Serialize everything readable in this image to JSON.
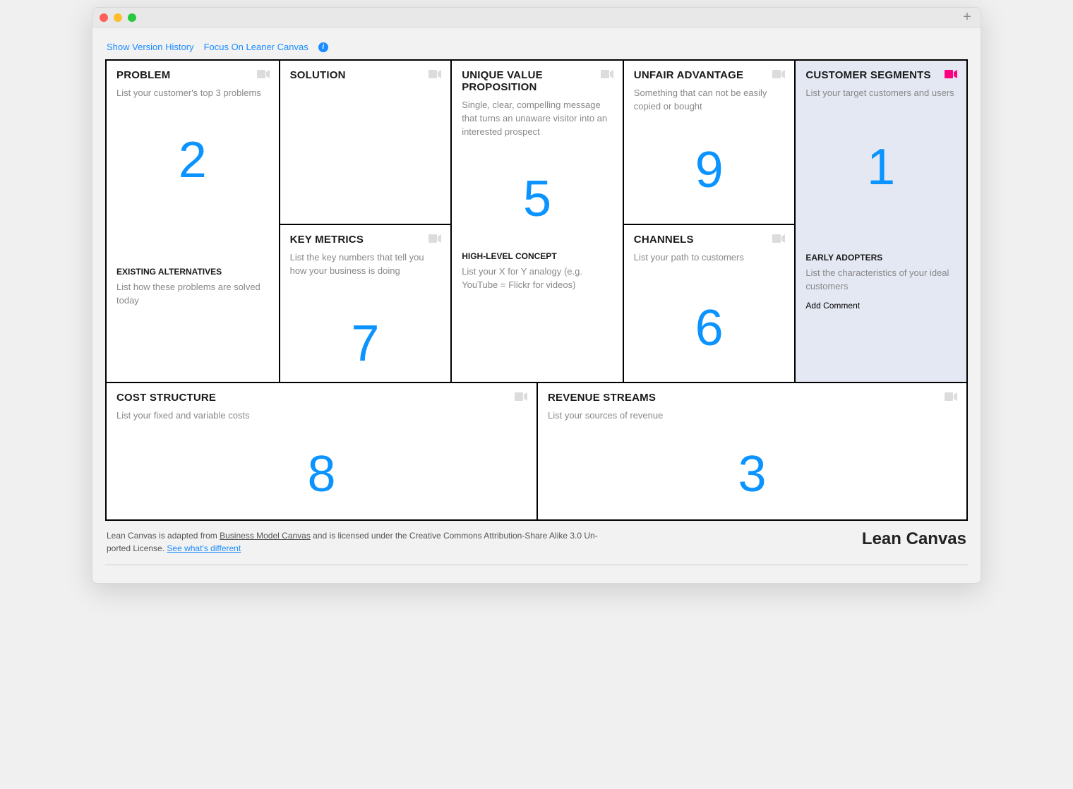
{
  "toolbar": {
    "version_history": "Show Version History",
    "focus": "Focus On Leaner Canvas"
  },
  "blocks": {
    "problem": {
      "title": "PROBLEM",
      "hint": "List your customer's top 3 problems",
      "number": "2"
    },
    "existing": {
      "title": "EXISTING ALTERNATIVES",
      "hint": "List how these problems are solved today"
    },
    "solution": {
      "title": "SOLUTION",
      "hint": "",
      "number": ""
    },
    "metrics": {
      "title": "KEY METRICS",
      "hint": "List the key numbers that tell you how your business is doing",
      "number": "7"
    },
    "uvp": {
      "title": "UNIQUE VALUE PROPOSITION",
      "hint": "Single, clear, compelling message that turns an unaware visitor into an interested prospect",
      "number": "5"
    },
    "concept": {
      "title": "HIGH-LEVEL CONCEPT",
      "hint": "List your X for Y analogy (e.g. YouTube = Flickr for videos)"
    },
    "unfair": {
      "title": "UNFAIR ADVANTAGE",
      "hint": "Something that can not be easily copied or bought",
      "number": "9"
    },
    "channels": {
      "title": "CHANNELS",
      "hint": "List your path to customers",
      "number": "6"
    },
    "segments": {
      "title": "CUSTOMER SEGMENTS",
      "hint": "List your target customers and users",
      "number": "1"
    },
    "adopters": {
      "title": "EARLY ADOPTERS",
      "hint": "List the characteristics of your ideal customers"
    },
    "cost": {
      "title": "COST STRUCTURE",
      "hint": "List your fixed and variable costs",
      "number": "8"
    },
    "revenue": {
      "title": "REVENUE STREAMS",
      "hint": "List your sources of revenue",
      "number": "3"
    }
  },
  "actions": {
    "add_comment": "Add Comment"
  },
  "footer": {
    "text1": "Lean Canvas is adapted from ",
    "bmc": "Business Model Canvas",
    "text2": " and is licensed under the Creative Commons Attribution-Share Alike 3.0 Un-ported License. ",
    "diff": "See what's different",
    "brand": "Lean Canvas"
  }
}
